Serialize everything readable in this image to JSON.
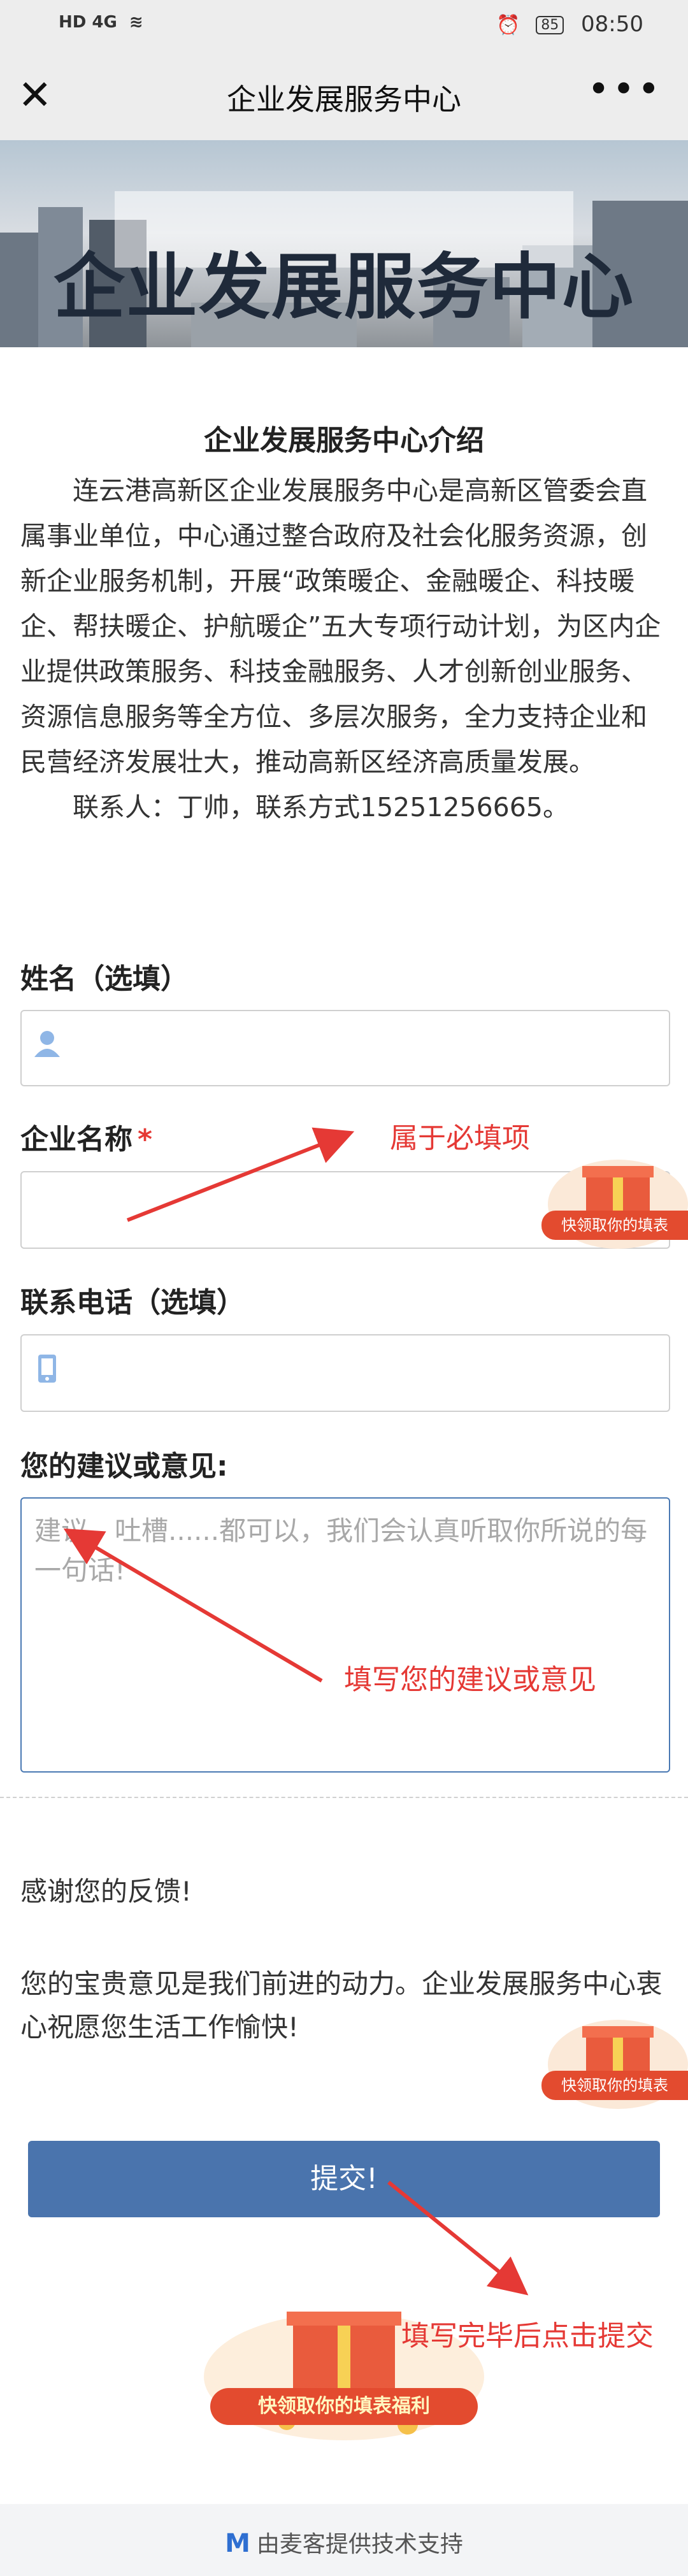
{
  "status_bar": {
    "network": "HD 4G",
    "battery": "85",
    "time": "08:50"
  },
  "nav": {
    "title": "企业发展服务中心",
    "more": "•••"
  },
  "banner": {
    "title": "企业发展服务中心"
  },
  "intro": {
    "title": "企业发展服务中心介绍",
    "paragraph": "连云港高新区企业发展服务中心是高新区管委会直属事业单位，中心通过整合政府及社会化服务资源，创新企业服务机制，开展“政策暖企、金融暖企、科技暖企、帮扶暖企、护航暖企”五大专项行动计划，为区内企业提供政策服务、科技金融服务、人才创新创业服务、资源信息服务等全方位、多层次服务，全力支持企业和民营经济发展壮大，推动高新区经济高质量发展。",
    "contact": "联系人：丁帅，联系方式15251256665。"
  },
  "form": {
    "name_label": "姓名（选填）",
    "company_label": "企业名称",
    "required_mark": "*",
    "phone_label": "联系电话（选填）",
    "suggestion_label": "您的建议或意见:",
    "suggestion_placeholder": "建议、吐槽......都可以，我们会认真听取你所说的每一句话!",
    "submit_label": "提交!"
  },
  "thanks": {
    "line1": "感谢您的反馈!",
    "line2": "您的宝贵意见是我们前进的动力。企业发展服务中心衷心祝愿您生活工作愉快!"
  },
  "promo": {
    "side_label": "快领取你的填表",
    "banner_label": "快领取你的填表福利"
  },
  "annotations": {
    "required": "属于必填项",
    "suggestion": "填写您的建议或意见",
    "submit": "填写完毕后点击提交"
  },
  "footer": {
    "text": "由麦客提供技术支持"
  },
  "colors": {
    "accent": "#4a74ad",
    "annotation": "#e53935"
  }
}
